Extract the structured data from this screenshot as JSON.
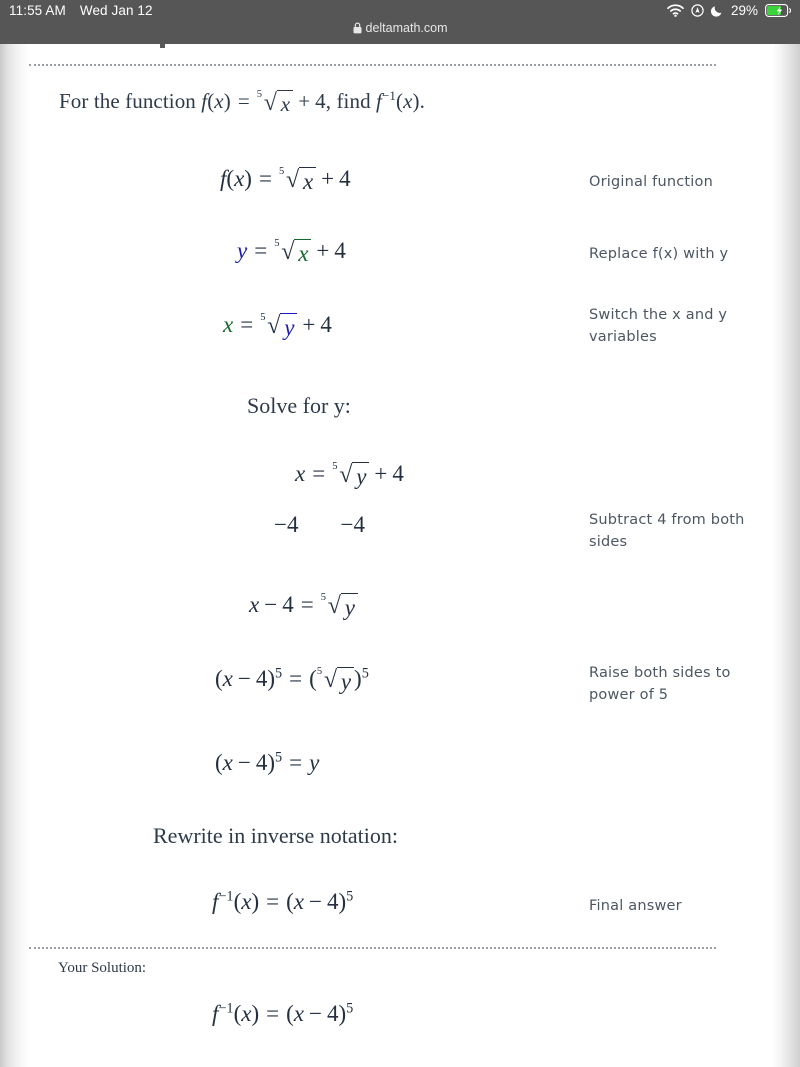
{
  "status_bar": {
    "time": "11:55 AM",
    "date": "Wed Jan 12",
    "battery_percent": "29%",
    "icons": [
      "wifi-icon",
      "location-icon",
      "do-not-disturb-moon-icon",
      "battery-charging-icon"
    ]
  },
  "browser": {
    "url": "deltamath.com",
    "lock_icon": "lock-icon"
  },
  "problem": {
    "prompt_prefix": "For the function ",
    "prompt_mid": ", find ",
    "prompt_suffix": "."
  },
  "steps": [
    {
      "note": "Original function"
    },
    {
      "note": "Replace f(x) with y"
    },
    {
      "note": "Switch the x and y variables"
    },
    {
      "note": "Subtract 4 from both sides"
    },
    {
      "note": "Raise both sides to power of 5"
    },
    {
      "note": "Final answer"
    }
  ],
  "headings": {
    "solve_for_y": "Solve for y:",
    "rewrite_inverse": "Rewrite in inverse notation:",
    "your_solution": "Your Solution:"
  },
  "math": {
    "f": "f",
    "x": "x",
    "y": "y",
    "five": "5",
    "four": "4",
    "minus_four": "−4",
    "equals": "=",
    "plus": "+",
    "minus": "−",
    "radical_glyph": "√",
    "inverse_exp": "−1",
    "lparen": "(",
    "rparen": ")"
  },
  "colors": {
    "accent_blue": "#1a1ab4",
    "accent_green": "#13682b",
    "text": "#243041",
    "note_text": "#4c5663",
    "status_bar_bg": "#565656",
    "battery_green": "#3ad43a"
  }
}
